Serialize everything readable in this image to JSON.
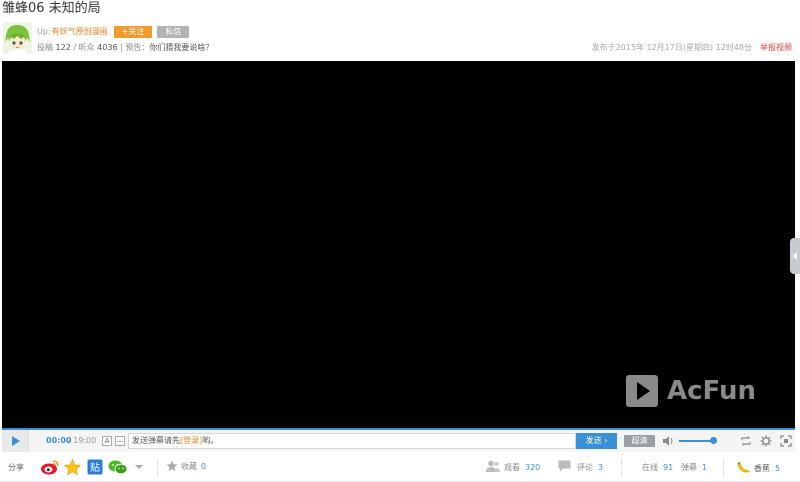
{
  "page": {
    "title": "雏蜂06 未知的局"
  },
  "uploader": {
    "prefix": "Up:",
    "name": "有妖气原创漫画",
    "follow_label": "+关注",
    "message_label": "私信"
  },
  "stats": {
    "posts_label": "投稿",
    "posts": "122",
    "listeners_label": "/ 听众",
    "listeners": "4036",
    "preview_label": "| 预告：",
    "preview_text": "你们猜我要说啥？"
  },
  "post_time": "发布于2015年 12月17日(星期四) 12时48分",
  "report_label": "举报视频",
  "player": {
    "current_time": "00:00",
    "total_time": "/ 19:00",
    "danmaku_btn_a": "A",
    "danmaku_btn_b": "—",
    "input_prefix": "发送弹幕请先",
    "input_login": "[登录]",
    "input_suffix": "哟。",
    "send_label": "发送 ›",
    "quality_label": "超清",
    "logo_text": "AcFun",
    "accent": "#3a8fd9"
  },
  "bottom": {
    "share_label": "分享",
    "fav_label": "收藏",
    "fav_count": "0",
    "views_label": "观看",
    "views": "320",
    "comments_label": "评论",
    "comments": "3",
    "online_label": "在线",
    "online": "91",
    "danmaku_label": "弹幕",
    "danmaku": "1",
    "banana_label": "香蕉",
    "banana": "5"
  }
}
